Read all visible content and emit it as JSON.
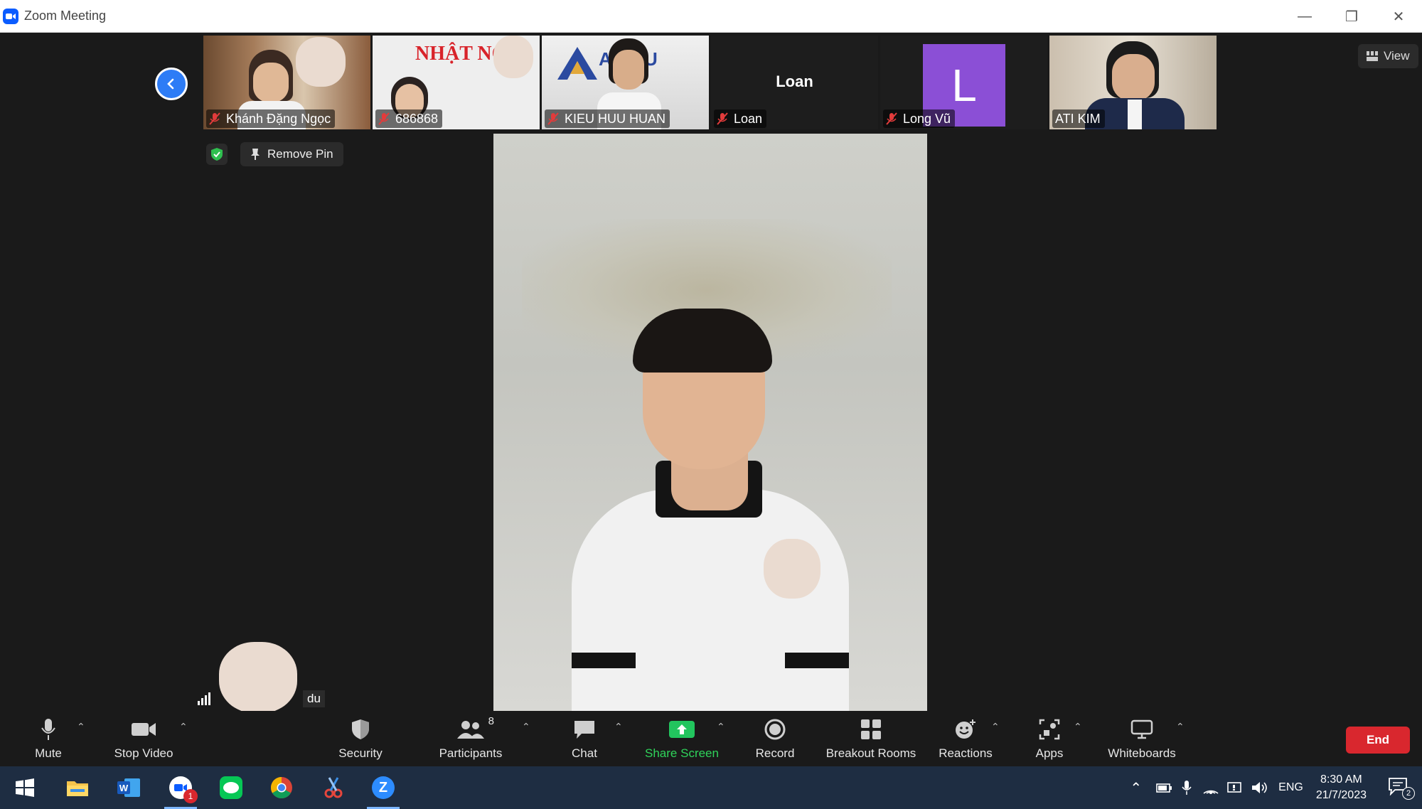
{
  "window": {
    "title": "Zoom Meeting"
  },
  "participants_strip": [
    {
      "name": "Khánh Đặng Ngọc",
      "muted": true
    },
    {
      "name": "686868",
      "muted": true,
      "sign": "NHẬT NG"
    },
    {
      "name": "KIEU HUU HUAN",
      "muted": true,
      "sign": "A  ROU"
    },
    {
      "name": "Loan",
      "muted": true,
      "display": "Loan"
    },
    {
      "name": "Long Vũ",
      "muted": true,
      "avatar_letter": "L"
    },
    {
      "name": "ATI KIM",
      "muted": false
    }
  ],
  "controls": {
    "view_label": "View",
    "remove_pin_label": "Remove Pin"
  },
  "self_view": {
    "name_fragment": "du"
  },
  "toolbar": {
    "mute": "Mute",
    "stop_video": "Stop Video",
    "security": "Security",
    "participants": "Participants",
    "participants_count": "8",
    "chat": "Chat",
    "share_screen": "Share Screen",
    "record": "Record",
    "breakout_rooms": "Breakout Rooms",
    "reactions": "Reactions",
    "apps": "Apps",
    "whiteboards": "Whiteboards",
    "end": "End"
  },
  "taskbar": {
    "zoom_badge": "1",
    "language": "ENG",
    "time": "8:30 AM",
    "date": "21/7/2023",
    "notifications": "2"
  },
  "colors": {
    "accent": "#2d7cf6",
    "end": "#d9272e",
    "share": "#22c55e",
    "avatar": "#8b4fd6"
  }
}
